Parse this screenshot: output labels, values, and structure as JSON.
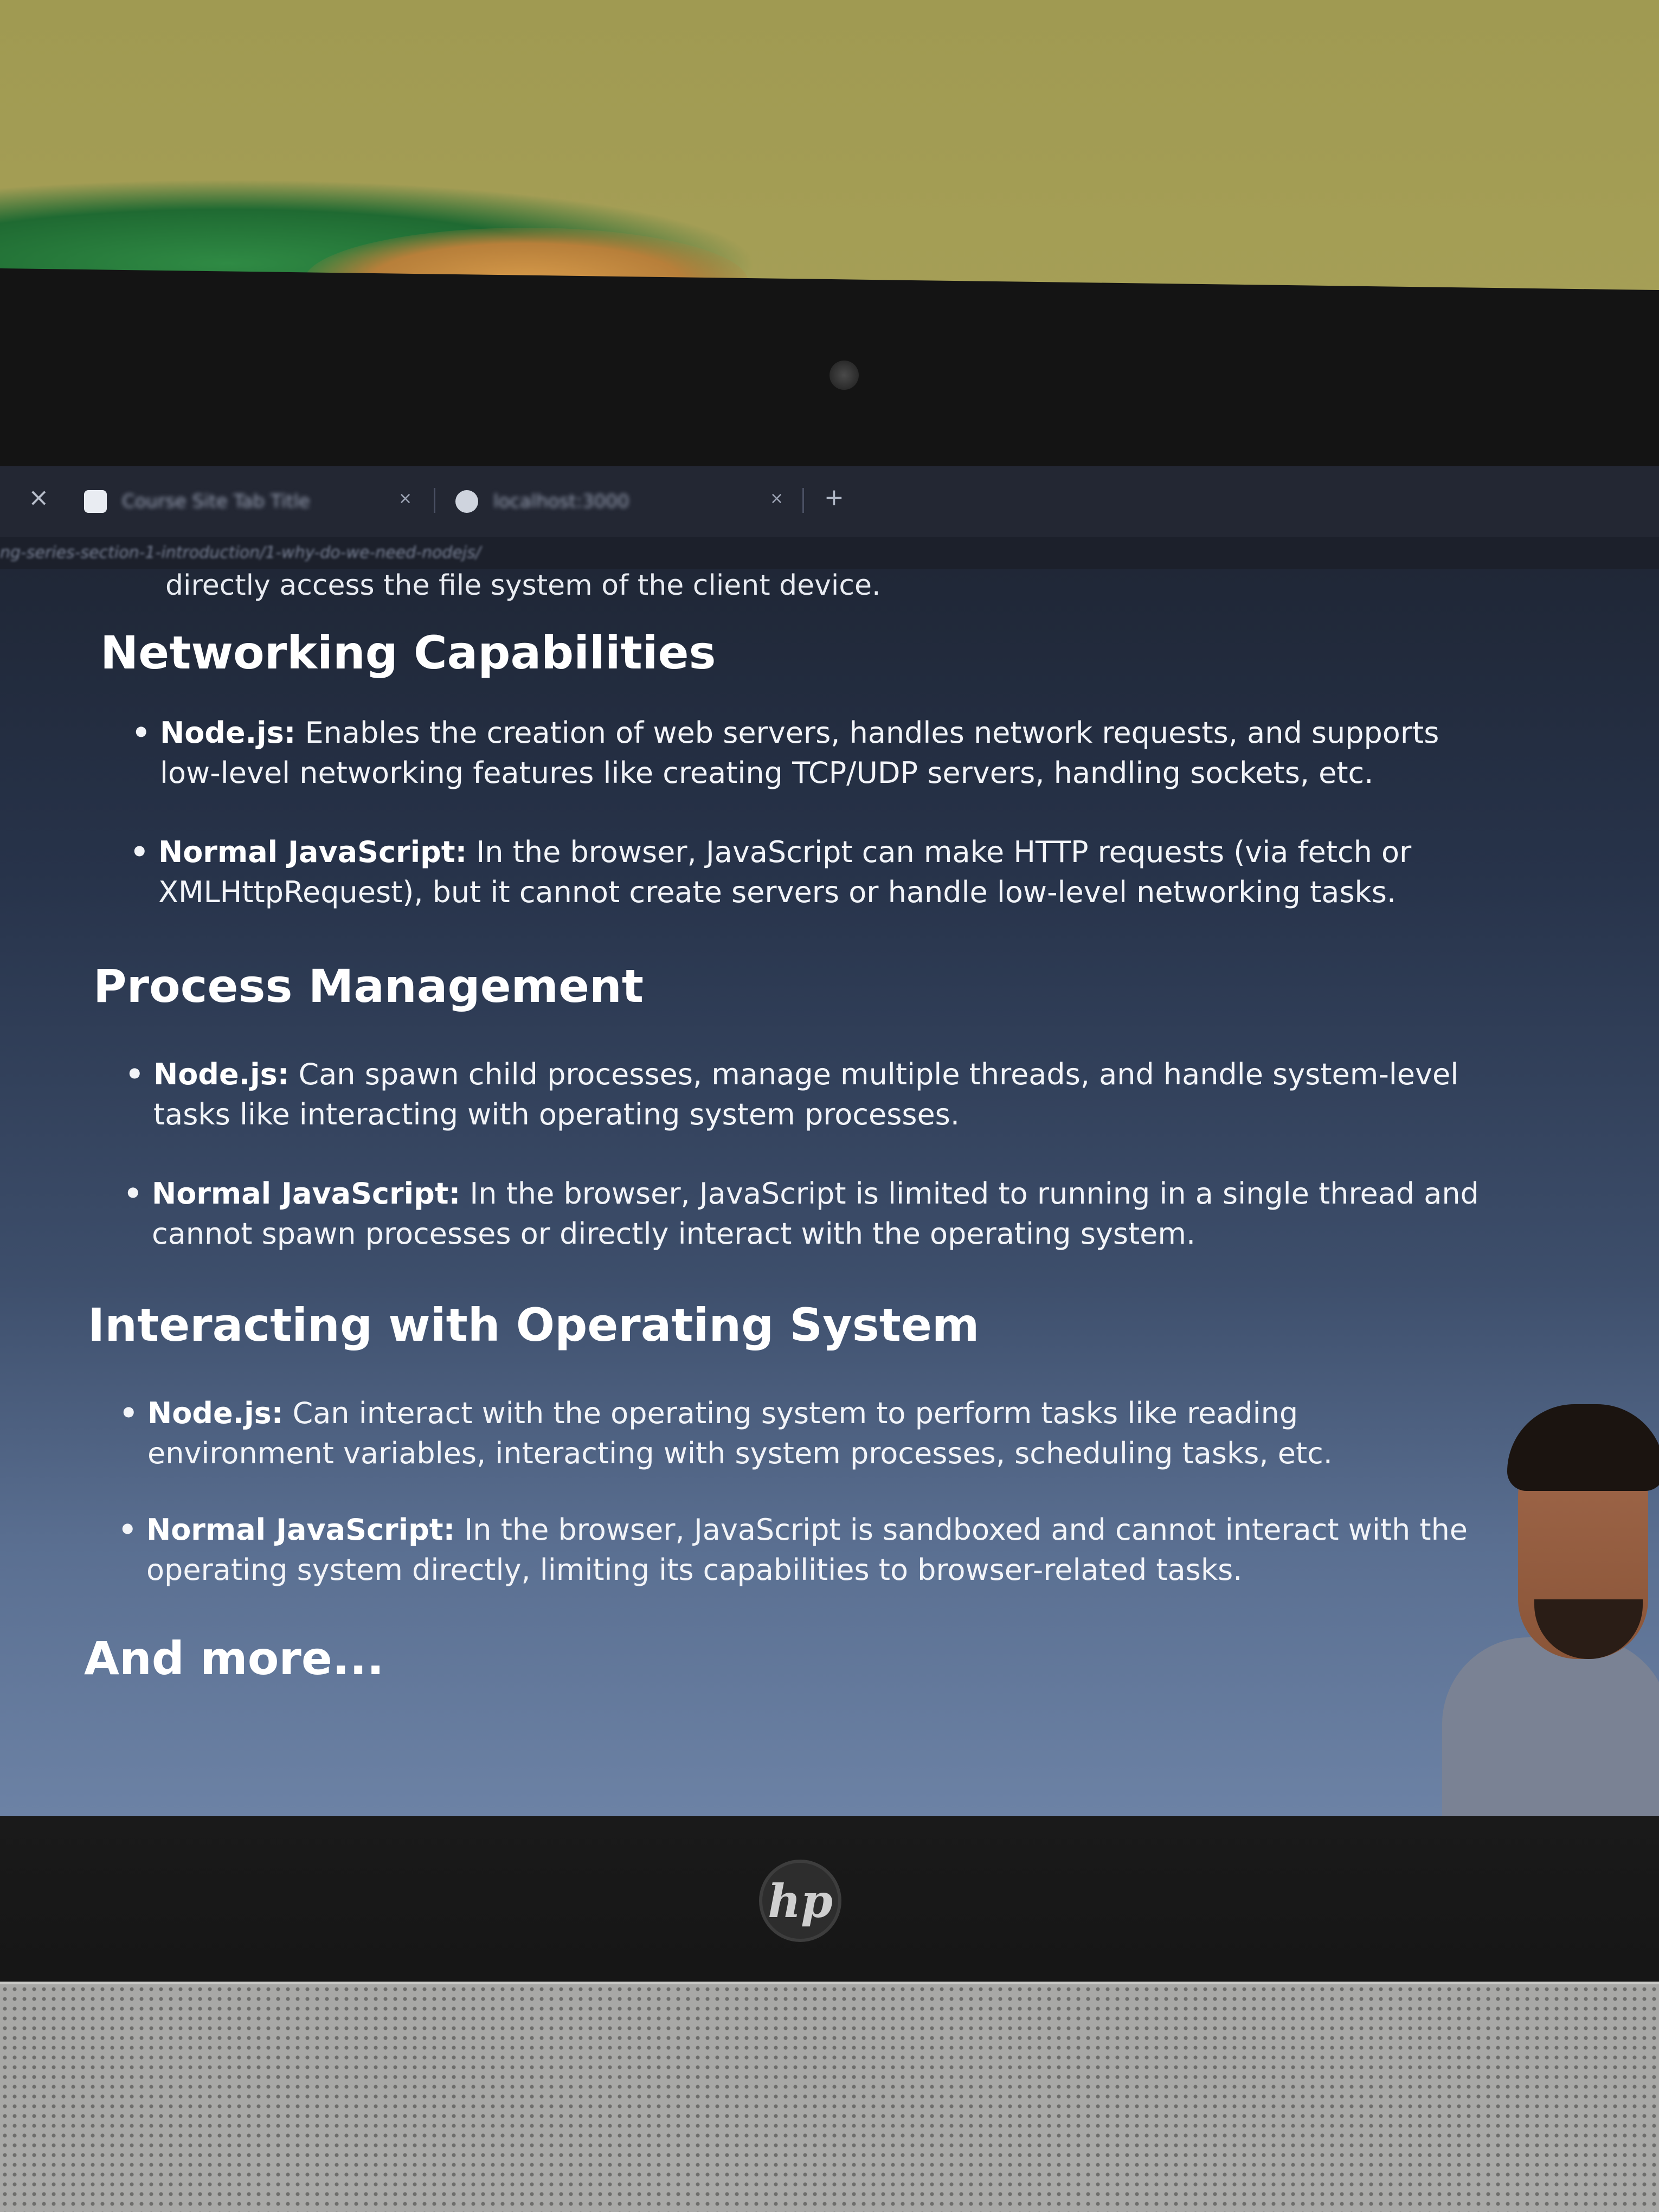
{
  "browser": {
    "tabs": [
      {
        "label": "Course Site Tab Title",
        "active": true
      },
      {
        "label": "localhost:3000",
        "active": false
      }
    ],
    "address": "ng-series-section-1-introduction/1-why-do-we-need-nodejs/"
  },
  "content": {
    "top_line": "directly access the file system of the client device.",
    "sections": [
      {
        "heading": "Networking Capabilities",
        "bullets": [
          {
            "term": "Node.js:",
            "text": " Enables the creation of web servers, handles network requests, and supports low-level networking features like creating TCP/UDP servers, handling sockets, etc."
          },
          {
            "term": "Normal JavaScript:",
            "text": " In the browser, JavaScript can make HTTP requests (via fetch or XMLHttpRequest), but it cannot create servers or handle low-level networking tasks."
          }
        ]
      },
      {
        "heading": "Process Management",
        "bullets": [
          {
            "term": "Node.js:",
            "text": " Can spawn child processes, manage multiple threads, and handle system-level tasks like interacting with operating system processes."
          },
          {
            "term": "Normal JavaScript:",
            "text": " In the browser, JavaScript is limited to running in a single thread and cannot spawn processes or directly interact with the operating system."
          }
        ]
      },
      {
        "heading": "Interacting with Operating System",
        "bullets": [
          {
            "term": "Node.js:",
            "text": " Can interact with the operating system to perform tasks like reading environment variables, interacting with system processes, scheduling tasks, etc."
          },
          {
            "term": "Normal JavaScript:",
            "text": " In the browser, JavaScript is sandboxed and cannot interact with the operating system directly, limiting its capabilities to browser-related tasks."
          }
        ]
      }
    ],
    "closing": "And more..."
  },
  "hardware": {
    "logo": "hp"
  },
  "icons": {
    "close": "close-icon",
    "new_tab": "plus-icon",
    "favicon": "page-icon",
    "globe": "globe-icon",
    "webcam": "webcam-icon"
  }
}
